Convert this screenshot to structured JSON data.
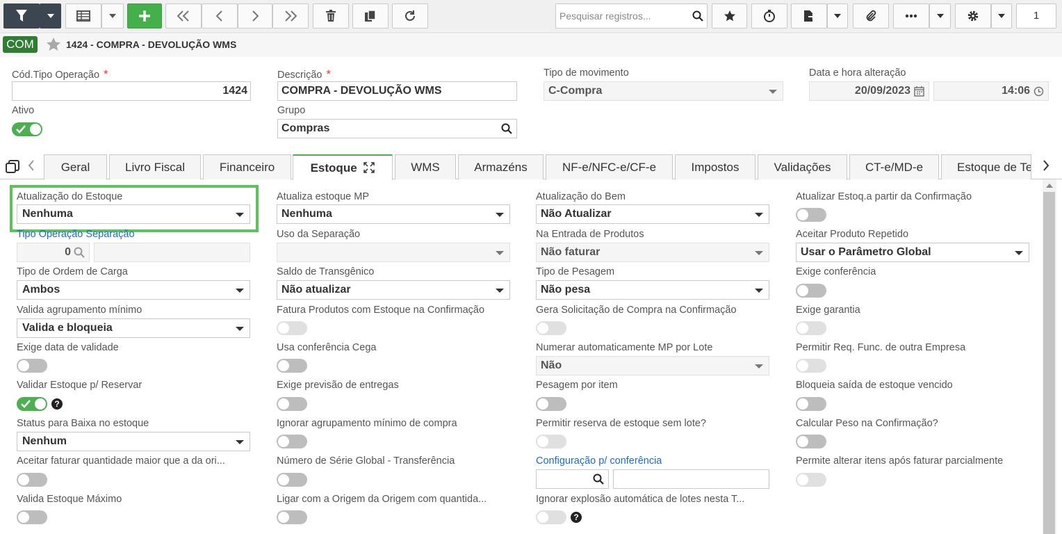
{
  "toolbar": {
    "search_placeholder": "Pesquisar registros...",
    "page_number": "1",
    "accent_green": "#43b04a",
    "dark_button": "#3c4650",
    "icons": [
      "filter-icon",
      "chevron-down-icon",
      "grid-icon",
      "plus-icon",
      "first-page-icon",
      "prev-icon",
      "next-icon",
      "last-page-icon",
      "trash-icon",
      "copy-icon",
      "refresh-icon",
      "search-icon",
      "star-icon",
      "stopwatch-icon",
      "export-icon",
      "paperclip-icon",
      "ellipsis-icon",
      "gear-icon"
    ]
  },
  "header": {
    "badge": "COM",
    "title": "1424 - COMPRA - DEVOLUÇÃO WMS",
    "badge_color": "#2e7d32"
  },
  "form": {
    "cod_label": "Cód.Tipo Operação",
    "cod_value": "1424",
    "required_mark": "*",
    "descricao_label": "Descrição",
    "descricao_value": "COMPRA - DEVOLUÇÃO WMS",
    "tipo_mov_label": "Tipo de movimento",
    "tipo_mov_value": "C-Compra",
    "data_label": "Data e hora alteração",
    "data_value": "20/09/2023",
    "hora_value": "14:06",
    "ativo_label": "Ativo",
    "ativo_on": true,
    "grupo_label": "Grupo",
    "grupo_value": "Compras"
  },
  "tabs": [
    "Geral",
    "Livro Fiscal",
    "Financeiro",
    "Estoque",
    "WMS",
    "Armazéns",
    "NF-e/NFC-e/CF-e",
    "Impostos",
    "Validações",
    "CT-e/MD-e",
    "Estoque de Te"
  ],
  "active_tab": "Estoque",
  "estoque": {
    "col1": {
      "atualizacao_label": "Atualização do Estoque",
      "atualizacao_value": "Nenhuma",
      "tipo_sep_label": "Tipo Operação Separação",
      "tipo_sep_value": "0",
      "tipo_ordem_label": "Tipo de Ordem de Carga",
      "tipo_ordem_value": "Ambos",
      "valida_agrup_label": "Valida agrupamento mínimo",
      "valida_agrup_value": "Valida e bloqueia",
      "exige_data_label": "Exige data de validade",
      "validar_reservar_label": "Validar Estoque p/ Reservar",
      "status_baixa_label": "Status para Baixa no estoque",
      "status_baixa_value": "Nenhum",
      "aceitar_faturar_label": "Aceitar faturar quantidade maior que a da ori...",
      "valida_max_label": "Valida Estoque Máximo"
    },
    "col2": {
      "atualiza_mp_label": "Atualiza estoque MP",
      "atualiza_mp_value": "Nenhuma",
      "uso_sep_label": "Uso da Separação",
      "saldo_trans_label": "Saldo de Transgênico",
      "saldo_trans_value": "Não atualizar",
      "fatura_prod_label": "Fatura Produtos com Estoque na Confirmação",
      "usa_conf_label": "Usa conferência Cega",
      "exige_prev_label": "Exige previsão de entregas",
      "ignorar_agrup_label": "Ignorar agrupamento mínimo de compra",
      "num_serie_label": "Número de Série Global - Transferência",
      "ligar_origem_label": "Ligar com a Origem da Origem com quantida..."
    },
    "col3": {
      "atualiza_bem_label": "Atualização do Bem",
      "atualiza_bem_value": "Não Atualizar",
      "na_entrada_label": "Na Entrada de Produtos",
      "na_entrada_value": "Não faturar",
      "tipo_pesagem_label": "Tipo de Pesagem",
      "tipo_pesagem_value": "Não pesa",
      "gera_solic_label": "Gera Solicitação de Compra na Confirmação",
      "numerar_label": "Numerar automaticamente MP por Lote",
      "numerar_value": "Não",
      "pesagem_item_label": "Pesagem por item",
      "permitir_reserva_label": "Permitir reserva de estoque sem lote?",
      "config_conf_label": "Configuração p/ conferência",
      "ignorar_explosao_label": "Ignorar explosão automática de lotes nesta T..."
    },
    "col4": {
      "atualizar_conf_label": "Atualizar Estoq.a partir da Confirmação",
      "aceitar_rep_label": "Aceitar Produto Repetido",
      "aceitar_rep_value": "Usar o Parâmetro Global",
      "exige_conf_label": "Exige conferência",
      "exige_garantia_label": "Exige garantia",
      "permitir_req_label": "Permitir Req. Func. de outra Empresa",
      "bloqueia_label": "Bloqueia saída de estoque vencido",
      "calcular_peso_label": "Calcular Peso na Confirmação?",
      "permite_alterar_label": "Permite alterar itens após faturar parcialmente"
    },
    "help_mark": "?"
  }
}
